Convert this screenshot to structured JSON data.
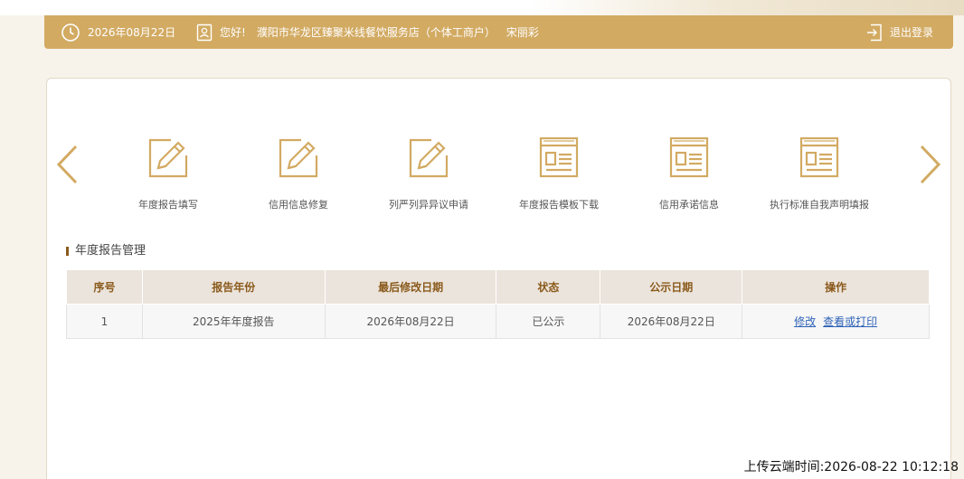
{
  "header": {
    "date": "2026年08月22日",
    "greeting": "您好!",
    "company": "濮阳市华龙区臻聚米线餐饮服务店（个体工商户）",
    "user_name": "宋丽彩",
    "logout_label": "退出登录"
  },
  "features": [
    {
      "label": "年度报告填写",
      "icon": "edit-icon"
    },
    {
      "label": "信用信息修复",
      "icon": "edit-icon"
    },
    {
      "label": "列严列异异议申请",
      "icon": "edit-icon"
    },
    {
      "label": "年度报告模板下载",
      "icon": "document-icon"
    },
    {
      "label": "信用承诺信息",
      "icon": "document-icon"
    },
    {
      "label": "执行标准自我声明填报",
      "icon": "document-icon"
    }
  ],
  "section": {
    "title": "年度报告管理"
  },
  "table": {
    "headers": [
      "序号",
      "报告年份",
      "最后修改日期",
      "状态",
      "公示日期",
      "操作"
    ],
    "rows": [
      {
        "index": "1",
        "year": "2025年年度报告",
        "modified": "2026年08月22日",
        "status": "已公示",
        "publish": "2026年08月22日",
        "action_edit": "修改",
        "action_view": "查看或打印"
      }
    ]
  },
  "footer": {
    "upload_time": "上传云端时间:2026-08-22 10:12:18"
  },
  "colors": {
    "accent": "#d2aa62",
    "header_text": "#8a5a1c",
    "link": "#2f63b8"
  }
}
